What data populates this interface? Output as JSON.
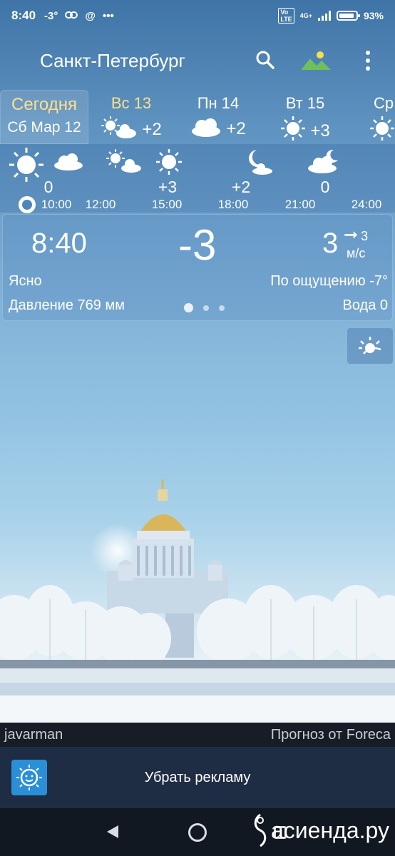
{
  "status_bar": {
    "time": "8:40",
    "temp": "-3°",
    "icons": [
      "link-icon",
      "at-icon",
      "more-dots-icon"
    ],
    "network": "4G+",
    "battery": "93%"
  },
  "app_bar": {
    "city": "Санкт-Петербург",
    "search_icon": "search-icon",
    "background_icon": "landscape-icon",
    "menu_icon": "overflow-menu-icon"
  },
  "days": [
    {
      "name": "Сегодня",
      "date": "Сб Мар 12",
      "selected": true
    },
    {
      "name": "Вс 13",
      "icon": "sun-cloud-icon",
      "temp": "+2"
    },
    {
      "name": "Пн 14",
      "icon": "cloud-icon",
      "temp": "+2"
    },
    {
      "name": "Вт 15",
      "icon": "sun-icon",
      "temp": "+3"
    },
    {
      "name": "Ср",
      "icon": "sun-icon",
      "temp": ""
    }
  ],
  "hourly": {
    "temps": [
      "0",
      "+3",
      "+2",
      "0"
    ],
    "hours": [
      "10:00",
      "12:00",
      "15:00",
      "18:00",
      "21:00",
      "24:00"
    ]
  },
  "current": {
    "time": "8:40",
    "temp": "-3",
    "wind_speed": "3",
    "wind_gust": "3",
    "wind_unit": "м/с",
    "condition": "Ясно",
    "feels_like": "По ощущению -7°",
    "pressure": "Давление 769 мм",
    "water": "Вода 0"
  },
  "credits": {
    "author": "javarman",
    "provider": "Прогноз от Foreca"
  },
  "ad": {
    "label": "Убрать рекламу"
  },
  "watermark": "асиенда.ру",
  "colors": {
    "sky_top": "#3f74a7",
    "today_highlight": "#ffe08a",
    "ad_bar": "#1f2d44",
    "credits_bar": "#161d26"
  }
}
